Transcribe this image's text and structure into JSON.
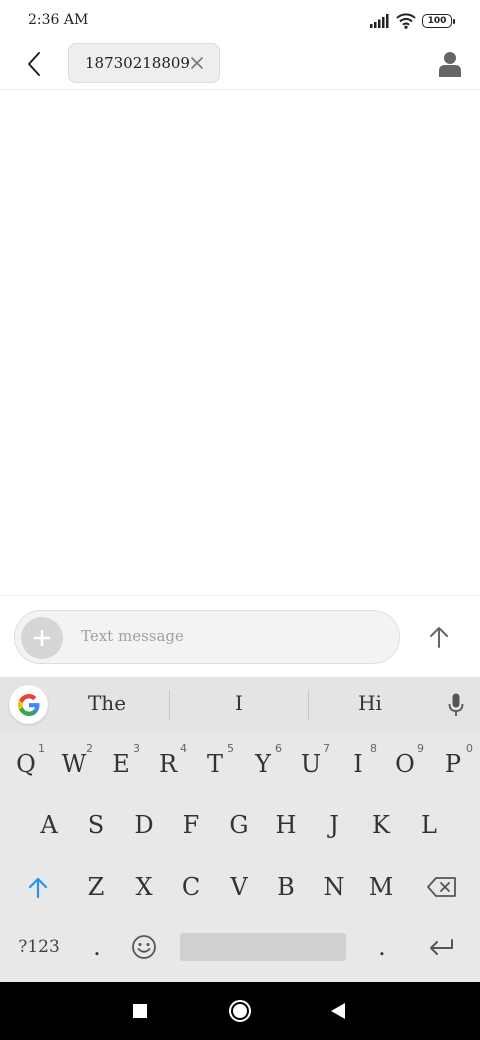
{
  "status_bar": {
    "time": "2:36 AM",
    "battery": "100"
  },
  "header": {
    "recipient": "18730218809"
  },
  "composer": {
    "placeholder": "Text message"
  },
  "keyboard": {
    "suggestions": [
      "The",
      "I",
      "Hi"
    ],
    "row1": [
      {
        "key": "Q",
        "hint": "1"
      },
      {
        "key": "W",
        "hint": "2"
      },
      {
        "key": "E",
        "hint": "3"
      },
      {
        "key": "R",
        "hint": "4"
      },
      {
        "key": "T",
        "hint": "5"
      },
      {
        "key": "Y",
        "hint": "6"
      },
      {
        "key": "U",
        "hint": "7"
      },
      {
        "key": "I",
        "hint": "8"
      },
      {
        "key": "O",
        "hint": "9"
      },
      {
        "key": "P",
        "hint": "0"
      }
    ],
    "row2": [
      "A",
      "S",
      "D",
      "F",
      "G",
      "H",
      "J",
      "K",
      "L"
    ],
    "row3": [
      "Z",
      "X",
      "C",
      "V",
      "B",
      "N",
      "M"
    ],
    "symbols_label": "?123",
    "comma_label": ".",
    "period_label": "."
  },
  "colors": {
    "accent_blue": "#2196f3",
    "keyboard_bg": "#e8e8e8",
    "nav_bg": "#000000"
  }
}
